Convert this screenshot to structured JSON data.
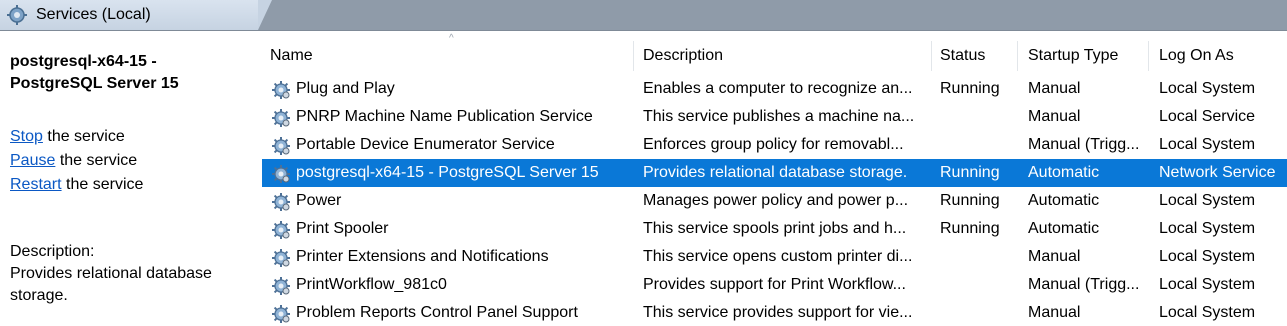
{
  "window": {
    "title": "Services (Local)"
  },
  "left_pane": {
    "service_title": "postgresql-x64-15 - PostgreSQL Server 15",
    "actions": [
      {
        "link": "Stop",
        "rest": " the service"
      },
      {
        "link": "Pause",
        "rest": " the service"
      },
      {
        "link": "Restart",
        "rest": " the service"
      }
    ],
    "description_label": "Description:",
    "description_text": "Provides relational database storage."
  },
  "table": {
    "columns": [
      "Name",
      "Description",
      "Status",
      "Startup Type",
      "Log On As"
    ],
    "sort_indicator": "^",
    "rows": [
      {
        "name": "Plug and Play",
        "description": "Enables a computer to recognize an...",
        "status": "Running",
        "startup": "Manual",
        "logon": "Local System"
      },
      {
        "name": "PNRP Machine Name Publication Service",
        "description": "This service publishes a machine na...",
        "status": "",
        "startup": "Manual",
        "logon": "Local Service"
      },
      {
        "name": "Portable Device Enumerator Service",
        "description": "Enforces group policy for removabl...",
        "status": "",
        "startup": "Manual (Trigg...",
        "logon": "Local System"
      },
      {
        "name": "postgresql-x64-15 - PostgreSQL Server 15",
        "description": "Provides relational database storage.",
        "status": "Running",
        "startup": "Automatic",
        "logon": "Network Service"
      },
      {
        "name": "Power",
        "description": "Manages power policy and power p...",
        "status": "Running",
        "startup": "Automatic",
        "logon": "Local System"
      },
      {
        "name": "Print Spooler",
        "description": "This service spools print jobs and h...",
        "status": "Running",
        "startup": "Automatic",
        "logon": "Local System"
      },
      {
        "name": "Printer Extensions and Notifications",
        "description": "This service opens custom printer di...",
        "status": "",
        "startup": "Manual",
        "logon": "Local System"
      },
      {
        "name": "PrintWorkflow_981c0",
        "description": "Provides support for Print Workflow...",
        "status": "",
        "startup": "Manual (Trigg...",
        "logon": "Local System"
      },
      {
        "name": "Problem Reports Control Panel Support",
        "description": "This service provides support for vie...",
        "status": "",
        "startup": "Manual",
        "logon": "Local System"
      }
    ],
    "selected_row": 3,
    "icon": "gear-service-icon"
  },
  "colors": {
    "selection": "#0a78d7",
    "link": "#0b58c4",
    "titlebar": "#8f9ba9"
  }
}
